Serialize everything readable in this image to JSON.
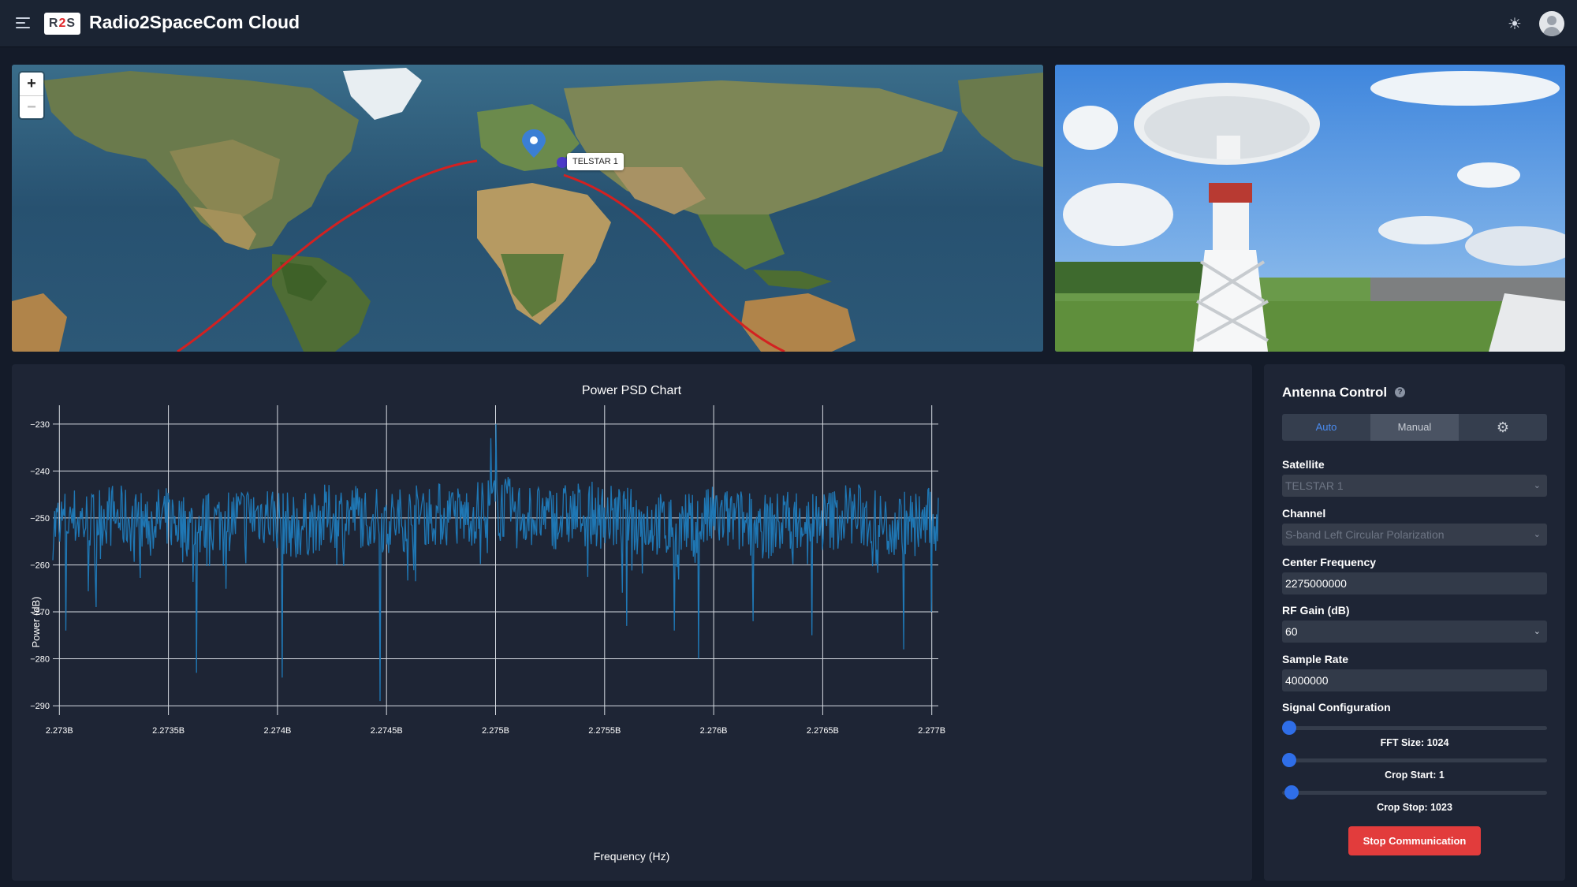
{
  "header": {
    "title": "Radio2SpaceCom Cloud",
    "logo": {
      "prefix": "R",
      "mid": "2",
      "suffix": "S"
    }
  },
  "map": {
    "zoom_in": "+",
    "zoom_out": "−",
    "satellite_label": "TELSTAR 1"
  },
  "chart_data": {
    "type": "line",
    "title": "Power PSD Chart",
    "xlabel": "Frequency (Hz)",
    "ylabel": "Power (dB)",
    "x_range": [
      2272970000,
      2277030000
    ],
    "ylim": [
      -292,
      -226
    ],
    "x_ticks": [
      2273000000,
      2273500000,
      2274000000,
      2274500000,
      2275000000,
      2275500000,
      2276000000,
      2276500000,
      2277000000
    ],
    "x_tick_labels": [
      "2.273B",
      "2.2735B",
      "2.274B",
      "2.2745B",
      "2.275B",
      "2.2755B",
      "2.276B",
      "2.2765B",
      "2.277B"
    ],
    "y_ticks": [
      -230,
      -240,
      -250,
      -260,
      -270,
      -280,
      -290
    ],
    "y_tick_labels": [
      "−230",
      "−240",
      "−250",
      "−260",
      "−270",
      "−280",
      "−290"
    ],
    "series_color": "#1f77b4",
    "grid": true,
    "series": [
      {
        "x": [
          2272970000,
          2273000000,
          2273060000,
          2273150000,
          2273200000,
          2273280000,
          2273380000,
          2273500000,
          2273620000,
          2273720000,
          2273800000,
          2273950000,
          2274000000,
          2274020000,
          2274100000,
          2274200000,
          2274350000,
          2274500000,
          2274600000,
          2274700000,
          2274850000,
          2275000000,
          2275100000,
          2275250000,
          2275400000,
          2275550000,
          2275700000,
          2275850000,
          2276000000,
          2276150000,
          2276250000,
          2276380000,
          2276500000,
          2276620000,
          2276700000,
          2276800000,
          2276850000,
          2276950000,
          2277030000
        ],
        "values": [
          -252,
          -251,
          -250,
          -251,
          -249,
          -250,
          -251,
          -250,
          -252,
          -251,
          -250,
          -249,
          -250,
          -251,
          -252,
          -250,
          -249,
          -251,
          -250,
          -249,
          -250,
          -247,
          -249,
          -250,
          -249,
          -250,
          -251,
          -252,
          -250,
          -251,
          -252,
          -250,
          -251,
          -249,
          -250,
          -252,
          -251,
          -251,
          -250
        ],
        "spikes": [
          {
            "x": 2273030000,
            "value": -274
          },
          {
            "x": 2273170000,
            "value": -269
          },
          {
            "x": 2273630000,
            "value": -283
          },
          {
            "x": 2274020000,
            "value": -284
          },
          {
            "x": 2274470000,
            "value": -289
          },
          {
            "x": 2274980000,
            "value": -233
          },
          {
            "x": 2275000000,
            "value": -230
          },
          {
            "x": 2275600000,
            "value": -273
          },
          {
            "x": 2275820000,
            "value": -274
          },
          {
            "x": 2275930000,
            "value": -280
          },
          {
            "x": 2276180000,
            "value": -272
          },
          {
            "x": 2276450000,
            "value": -275
          },
          {
            "x": 2276870000,
            "value": -278
          },
          {
            "x": 2277000000,
            "value": -270
          }
        ]
      }
    ]
  },
  "control": {
    "title": "Antenna Control",
    "help": "?",
    "tabs": {
      "auto": "Auto",
      "manual": "Manual",
      "settings_icon": "gear-icon"
    },
    "satellite_label": "Satellite",
    "satellite_value": "TELSTAR 1",
    "channel_label": "Channel",
    "channel_value": "S-band Left Circular Polarization",
    "center_freq_label": "Center Frequency",
    "center_freq_value": "2275000000",
    "rf_gain_label": "RF Gain (dB)",
    "rf_gain_value": "60",
    "sample_rate_label": "Sample Rate",
    "sample_rate_value": "4000000",
    "signal_config_label": "Signal Configuration",
    "fft_label": "FFT Size: 1024",
    "fft_level": 0.0,
    "crop_start_label": "Crop Start: 1",
    "crop_start_level": 0.0,
    "crop_stop_label": "Crop Stop: 1023",
    "crop_stop_level": 0.01,
    "stop_button": "Stop Communication"
  }
}
